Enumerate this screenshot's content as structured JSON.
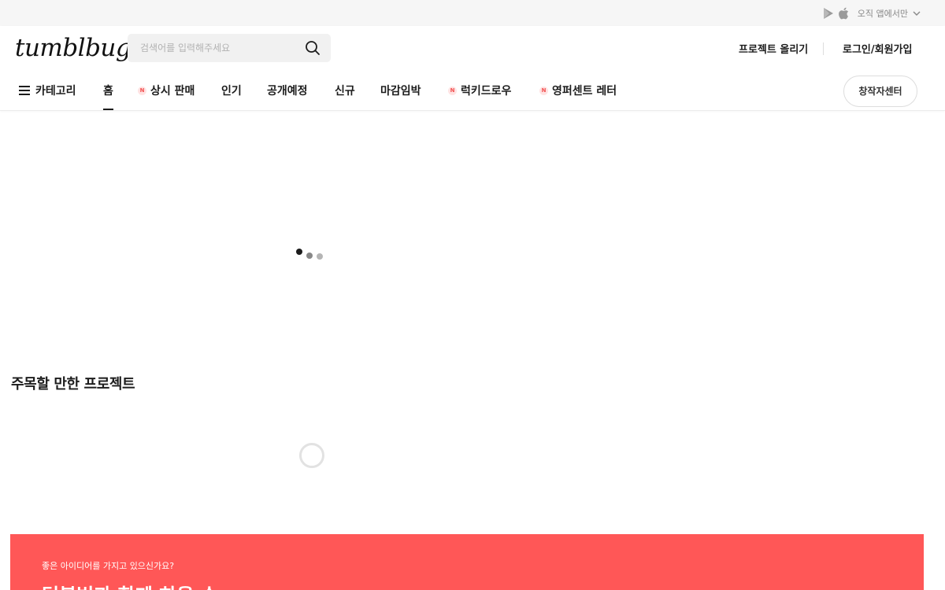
{
  "top_strip": {
    "app_text": "오직 앱에서만",
    "icons": [
      "google-play-icon",
      "apple-icon",
      "chevron-down-icon"
    ]
  },
  "header": {
    "logo": "tumblbug",
    "search": {
      "placeholder": "검색어를 입력해주세요",
      "value": ""
    },
    "upload_link": "프로젝트 올리기",
    "login_link": "로그인/회원가입"
  },
  "nav": {
    "category": "카테고리",
    "items": [
      {
        "label": "홈",
        "new": false,
        "active": true
      },
      {
        "label": "상시 판매",
        "new": true,
        "active": false
      },
      {
        "label": "인기",
        "new": false,
        "active": false
      },
      {
        "label": "공개예정",
        "new": false,
        "active": false
      },
      {
        "label": "신규",
        "new": false,
        "active": false
      },
      {
        "label": "마감임박",
        "new": false,
        "active": false
      },
      {
        "label": "럭키드로우",
        "new": true,
        "active": false
      },
      {
        "label": "영퍼센트 레터",
        "new": true,
        "active": false
      }
    ],
    "new_badge": "N",
    "creator_center": "창작자센터"
  },
  "section": {
    "title": "주목할 만한 프로젝트"
  },
  "banner": {
    "subtitle": "좋은 아이디어를 가지고 있으신가요?",
    "title": "텀블벅과 함께 하을 수"
  },
  "colors": {
    "accent": "#ff5757",
    "badge_text": "#f25252",
    "badge_bg": "#ffe3e3",
    "text": "#1c1c1c"
  }
}
